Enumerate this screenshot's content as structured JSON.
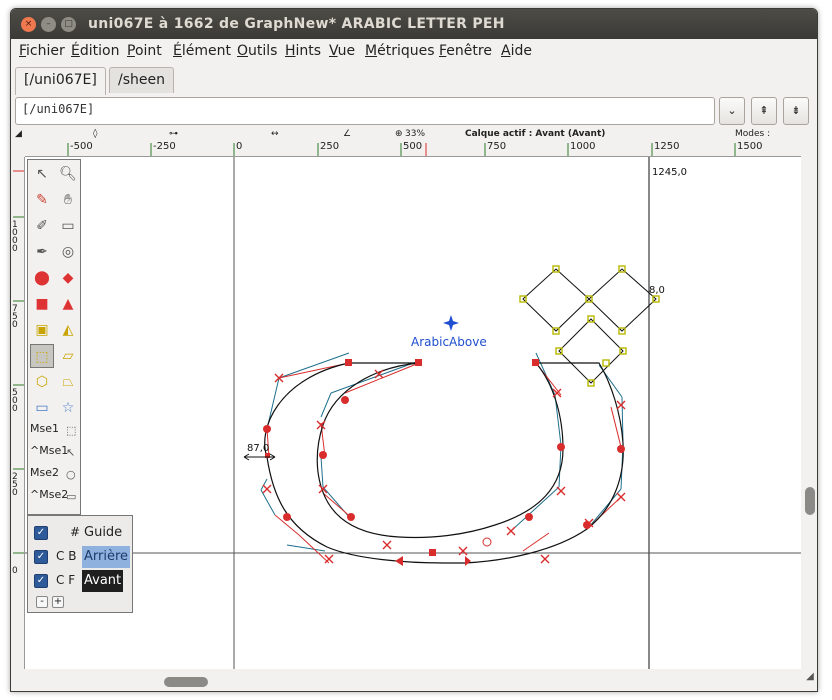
{
  "window": {
    "title": "uni067E à 1662 de GraphNew* ARABIC LETTER PEH",
    "controls": [
      "×",
      "–",
      "□"
    ]
  },
  "menubar": {
    "items": [
      "Fichier",
      "Édition",
      "Point",
      "Élément",
      "Outils",
      "Hints",
      "Vue",
      "Métriques",
      "Fenêtre",
      "Aide"
    ]
  },
  "tabs": [
    {
      "label": "[/uni067E]",
      "active": true
    },
    {
      "label": "/sheen",
      "active": false
    }
  ],
  "glyph_input": {
    "value": "[/uni067E]"
  },
  "input_buttons": {
    "dropdown": "⌄",
    "prev": "⇞",
    "next": "⇟"
  },
  "infobar": {
    "coord_x_icon": "◢",
    "point_icon": "◊",
    "curvature_icon": "⊶",
    "width_icon": "↔",
    "angle_icon": "∠",
    "zoom": "33%",
    "active_layer": "Calque actif : Avant (Avant)",
    "modes_label": "Modes :"
  },
  "ruler_h_labels": [
    "-500",
    "-250",
    "0",
    "250",
    "500",
    "750",
    "1000",
    "1250",
    "1500"
  ],
  "ruler_v_labels": [
    "1000",
    "750",
    "500",
    "250",
    "0"
  ],
  "canvas": {
    "advance_width_label": "1245,0",
    "left_bearing_label": "87,0",
    "anchor_label": "ArabicAbove",
    "dot_measure_label": "8,0",
    "guide_color": "#000000",
    "contour_color": "#000000",
    "point_color": "#d92d2d",
    "control_color": "#1f6f8b",
    "dot_point_color": "#c9c900",
    "anchor_color": "#1f4fcf"
  },
  "tools": {
    "mse1": "Mse1",
    "mse1_ctrl": "^Mse1",
    "mse2": "Mse2",
    "mse2_ctrl": "^Mse2"
  },
  "layers": {
    "guide": {
      "flags": "#",
      "name": "Guide",
      "checked": true
    },
    "back": {
      "flags": "C B",
      "name": "Arrière",
      "checked": true
    },
    "fore": {
      "flags": "C F",
      "name": "Avant",
      "checked": true
    },
    "minus": "-",
    "plus": "+"
  }
}
